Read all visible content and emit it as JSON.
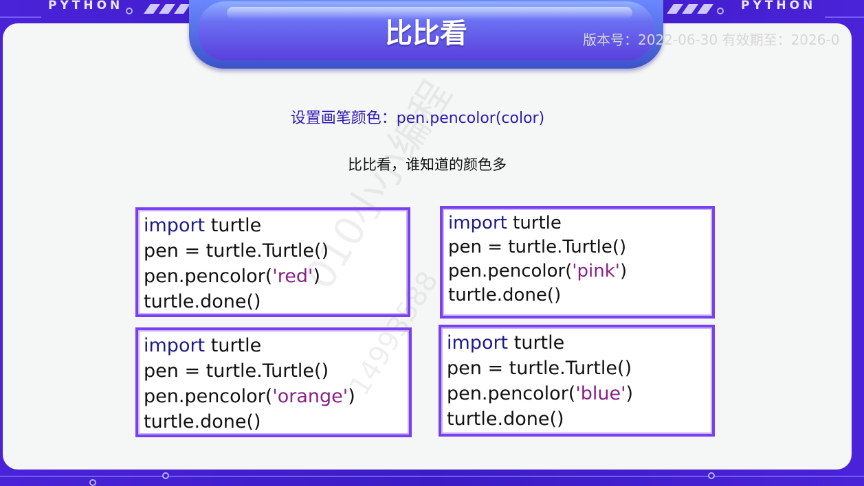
{
  "header": {
    "brand_left": "PYTHON",
    "brand_right": "PYTHON",
    "title": "比比看",
    "version_text": "版本号：2022-06-30 有效期至：2026-0"
  },
  "content": {
    "subtitle": "设置画笔颜色：pen.pencolor(color)",
    "prompt": "比比看，谁知道的颜色多"
  },
  "code_blocks": [
    {
      "kw": "import",
      "module": " turtle",
      "line2": "pen = turtle.Turtle()",
      "call": "pen.pencolor(",
      "arg": "'red'",
      "close": ")",
      "line4": "turtle.done()"
    },
    {
      "kw": "import",
      "module": " turtle",
      "line2": "pen = turtle.Turtle()",
      "call": "pen.pencolor(",
      "arg": "'pink'",
      "close": ")",
      "line4": "turtle.done()"
    },
    {
      "kw": "import",
      "module": " turtle",
      "line2": "pen = turtle.Turtle()",
      "call": "pen.pencolor(",
      "arg": "'orange'",
      "close": ")",
      "line4": "turtle.done()"
    },
    {
      "kw": "import",
      "module": " turtle",
      "line2": "pen = turtle.Turtle()",
      "call": "pen.pencolor(",
      "arg": "'blue'",
      "close": ")",
      "line4": "turtle.done()"
    }
  ],
  "watermark": {
    "line1": "010小小编程",
    "line2": "14993588"
  },
  "colors": {
    "frame": "#3a1fc9",
    "panel": "#f5f6f6",
    "code_border": "#7b3ff2",
    "keyword": "#1c1a8c",
    "string": "#8a1f86",
    "subtitle": "#2f17b6"
  }
}
